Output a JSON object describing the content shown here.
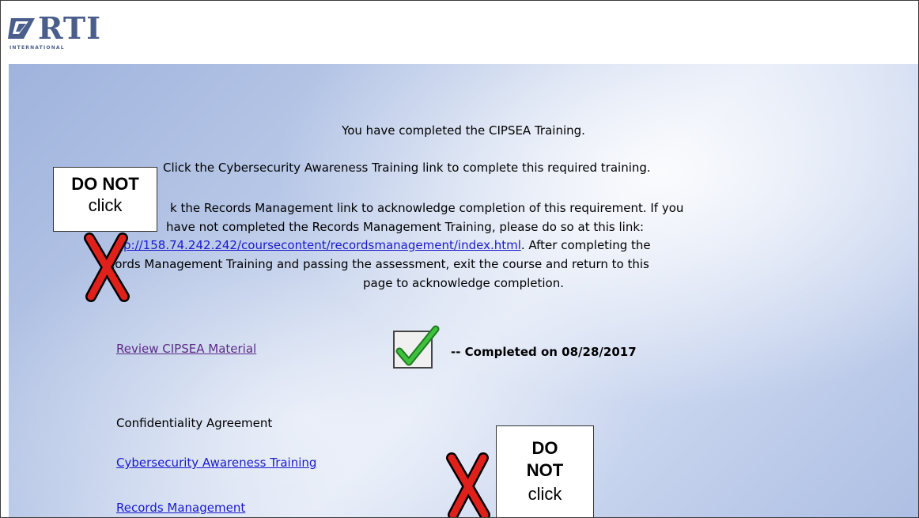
{
  "header": {
    "logo_text": "RTI",
    "logo_subtext": "INTERNATIONAL"
  },
  "main": {
    "completed_msg": "You have completed the CIPSEA Training.",
    "cyber_msg": "Click the Cybersecurity Awareness Training link to complete this required training.",
    "records_line1": "k the Records Management link to acknowledge completion of this requirement. If you",
    "records_line2": "have not completed the Records Management Training, please do so at this link:",
    "records_url": "p://158.74.242.242/coursecontent/recordsmanagement/index.html",
    "records_after_url": ". After completing the",
    "records_line4": "cords Management Training and passing the assessment, exit the course and return to this",
    "records_line5": "page to acknowledge completion.",
    "review_link": "Review CIPSEA Material",
    "completed_on": "-- Completed on 08/28/2017",
    "confidentiality_label": "Confidentiality Agreement",
    "cyber_link": "Cybersecurity Awareness Training",
    "records_link": "Records Management"
  },
  "callouts": {
    "top": {
      "line1": "DO NOT",
      "line2": "click"
    },
    "bottom": {
      "line1": "DO",
      "line2": "NOT",
      "line3": "click"
    }
  },
  "colors": {
    "link_blue": "#1a1acc",
    "visited_purple": "#5b2a86",
    "x_red": "#e0201a",
    "check_green": "#3ec23e"
  },
  "icons": [
    "rti-logo-icon",
    "checkbox-checked-icon",
    "red-x-icon"
  ]
}
